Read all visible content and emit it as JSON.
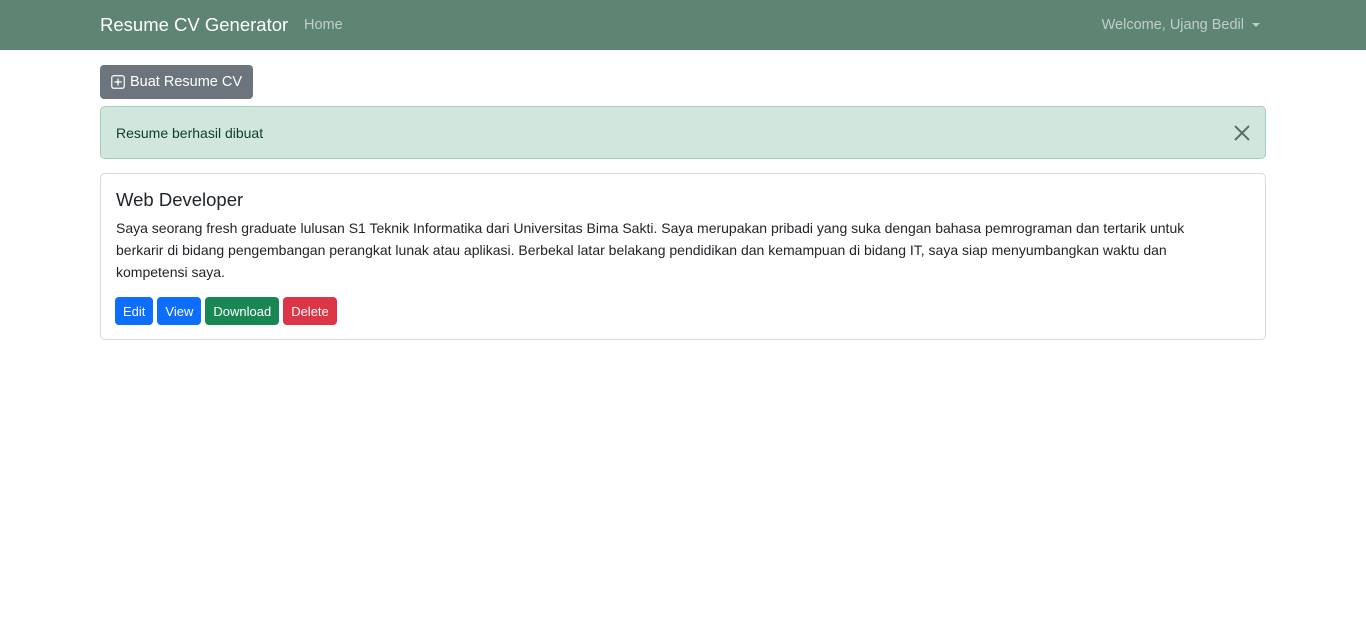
{
  "navbar": {
    "brand": "Resume CV Generator",
    "home": "Home",
    "user_menu": "Welcome, Ujang Bedil"
  },
  "toolbar": {
    "create_label": "Buat Resume CV",
    "create_icon": "plus-square-icon"
  },
  "alert": {
    "message": "Resume berhasil dibuat",
    "close_icon": "close-icon"
  },
  "resume": {
    "title": "Web Developer",
    "summary": "Saya seorang fresh graduate lulusan S1 Teknik Informatika dari Universitas Bima Sakti. Saya merupakan pribadi yang suka dengan bahasa pemrograman dan tertarik untuk berkarir di bidang pengembangan perangkat lunak atau aplikasi. Berbekal latar belakang pendidikan dan kemampuan di bidang IT, saya siap menyumbangkan waktu dan kompetensi saya.",
    "actions": {
      "edit": "Edit",
      "view": "View",
      "download": "Download",
      "delete": "Delete"
    }
  },
  "colors": {
    "navbar": "#5e8473",
    "secondary": "#6c757d",
    "primary": "#0d6efd",
    "success": "#198754",
    "danger": "#dc3545",
    "alert_bg": "#d1e7dd"
  }
}
